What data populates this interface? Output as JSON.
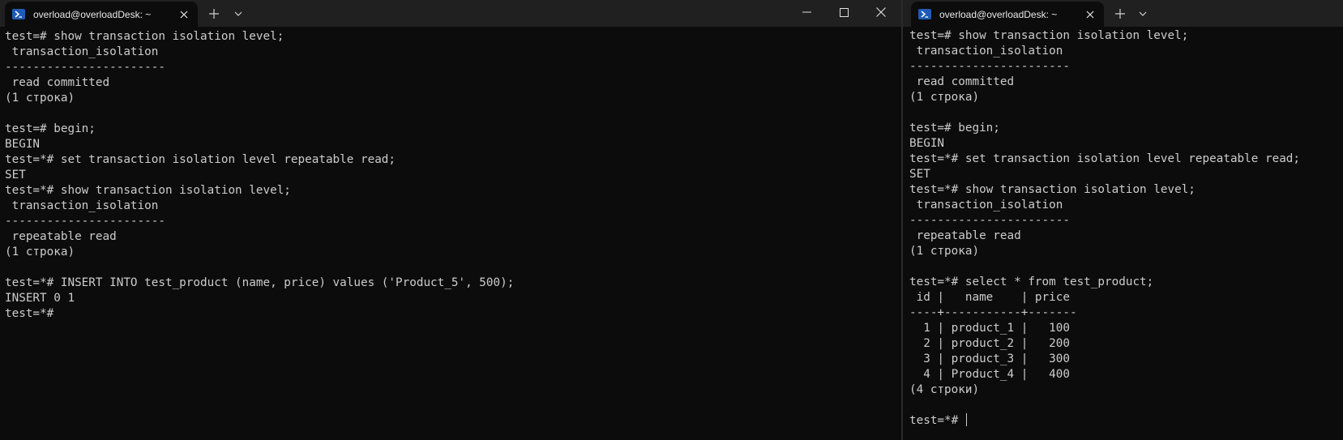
{
  "left_window": {
    "tab_title": "overload@overloadDesk: ~",
    "lines": [
      "test=# show transaction isolation level;",
      " transaction_isolation",
      "-----------------------",
      " read committed",
      "(1 строка)",
      "",
      "test=# begin;",
      "BEGIN",
      "test=*# set transaction isolation level repeatable read;",
      "SET",
      "test=*# show transaction isolation level;",
      " transaction_isolation",
      "-----------------------",
      " repeatable read",
      "(1 строка)",
      "",
      "test=*# INSERT INTO test_product (name, price) values ('Product_5', 500);",
      "INSERT 0 1",
      "test=*#"
    ]
  },
  "right_window": {
    "tab_title": "overload@overloadDesk: ~",
    "lines": [
      "test=# show transaction isolation level;",
      " transaction_isolation",
      "-----------------------",
      " read committed",
      "(1 строка)",
      "",
      "test=# begin;",
      "BEGIN",
      "test=*# set transaction isolation level repeatable read;",
      "SET",
      "test=*# show transaction isolation level;",
      " transaction_isolation",
      "-----------------------",
      " repeatable read",
      "(1 строка)",
      "",
      "test=*# select * from test_product;",
      " id |   name    | price",
      "----+-----------+-------",
      "  1 | product_1 |   100",
      "  2 | product_2 |   200",
      "  3 | product_3 |   300",
      "  4 | Product_4 |   400",
      "(4 строки)",
      ""
    ],
    "prompt": "test=*# "
  },
  "icons": [
    "powershell-icon",
    "close-icon",
    "plus-icon",
    "chevron-down-icon",
    "minimize-icon",
    "maximize-icon"
  ],
  "colors": {
    "background": "#0c0c0c",
    "text": "#cccccc",
    "titlebar": "#202020",
    "icon_accent": "#1e5bb8"
  }
}
